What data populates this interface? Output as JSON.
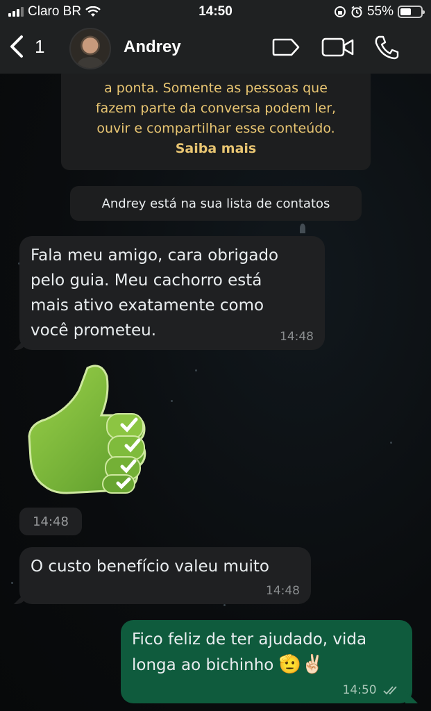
{
  "status_bar": {
    "carrier": "Claro BR",
    "time": "14:50",
    "battery": "55%",
    "battery_level": 0.55
  },
  "header": {
    "back_count": "1",
    "contact_name": "Andrey",
    "icons": [
      "chevron-left-icon",
      "label-tag-icon",
      "video-call-icon",
      "phone-icon"
    ]
  },
  "encryption_notice": {
    "lines": [
      "a ponta. Somente as pessoas que",
      "fazem parte da conversa podem ler,",
      "ouvir e compartilhar esse conteúdo."
    ],
    "link": "Saiba mais"
  },
  "contact_note": "Andrey está na sua lista de contatos",
  "messages": [
    {
      "direction": "in",
      "type": "text",
      "lines": [
        "Fala meu amigo, cara obrigado",
        "pelo guia. Meu cachorro está",
        "mais ativo exatamente como",
        "você prometeu."
      ],
      "time": "14:48"
    },
    {
      "direction": "in",
      "type": "sticker",
      "sticker": "green-thumbs-up-checkmarks",
      "time": "14:48"
    },
    {
      "direction": "in",
      "type": "text",
      "lines": [
        "O custo benefício valeu muito"
      ],
      "time": "14:48"
    },
    {
      "direction": "out",
      "type": "text",
      "lines": [
        "Fico feliz de ter ajudado, vida",
        "longa ao bichinho"
      ],
      "emoji": "🫡✌🏻",
      "time": "14:50",
      "status": "read-double-check"
    }
  ],
  "colors": {
    "incoming_bubble": "#1f2022",
    "outgoing_bubble": "#0f5b3d",
    "notice_text": "#e8c572"
  }
}
